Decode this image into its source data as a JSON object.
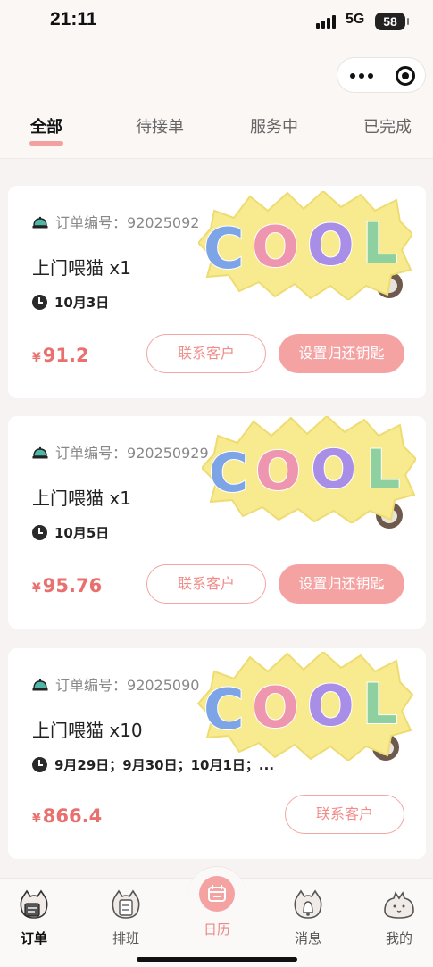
{
  "status_bar": {
    "time": "21:11",
    "network": "5G",
    "battery": "58"
  },
  "tabs": [
    {
      "label": "全部",
      "active": true
    },
    {
      "label": "待接单",
      "active": false
    },
    {
      "label": "服务中",
      "active": false
    },
    {
      "label": "已完成",
      "active": false
    }
  ],
  "orders": [
    {
      "order_prefix": "订单编号：",
      "order_no": "92025092",
      "service": "上门喂猫 x1",
      "dates": "10月3日",
      "price_symbol": "¥",
      "price": "91.2",
      "contact_label": "联系客户",
      "action_label": "设置归还钥匙"
    },
    {
      "order_prefix": "订单编号：",
      "order_no": "920250929",
      "service": "上门喂猫 x1",
      "dates": "10月5日",
      "price_symbol": "¥",
      "price": "95.76",
      "contact_label": "联系客户",
      "action_label": "设置归还钥匙"
    },
    {
      "order_prefix": "订单编号：",
      "order_no": "92025090",
      "service": "上门喂猫 x10",
      "dates": "9月29日；9月30日；10月1日；...",
      "price_symbol": "¥",
      "price": "866.4",
      "contact_label": "联系客户"
    }
  ],
  "sticker_text": "COOL",
  "nav": [
    {
      "label": "订单",
      "icon": "cat-order-icon",
      "active": true
    },
    {
      "label": "排班",
      "icon": "cat-schedule-icon",
      "active": false
    },
    {
      "label": "日历",
      "icon": "calendar-icon",
      "active": false
    },
    {
      "label": "消息",
      "icon": "cat-bell-icon",
      "active": false
    },
    {
      "label": "我的",
      "icon": "cat-profile-icon",
      "active": false
    }
  ],
  "colors": {
    "accent": "#f5a3a2",
    "price": "#e8706e",
    "sticker_blue": "#7ea4e8",
    "sticker_pink": "#ee95b0",
    "sticker_purple": "#a98ee8",
    "sticker_green": "#8fd0a0",
    "sticker_yellow": "#f8ea8e"
  }
}
